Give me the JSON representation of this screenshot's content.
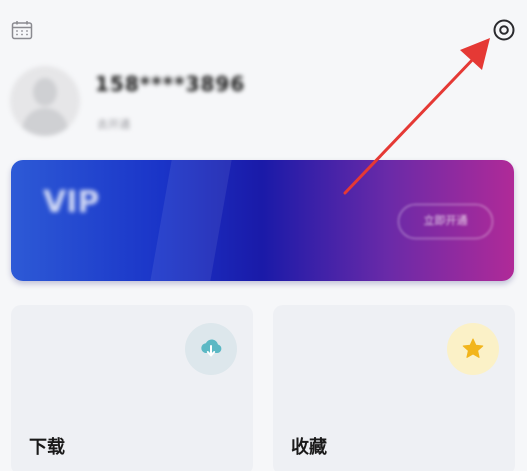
{
  "profile": {
    "phone": "158****3896",
    "subline": "去开通"
  },
  "vip_card": {
    "title": "VIP",
    "subtitle": "",
    "button_label": "立即开通"
  },
  "tiles": [
    {
      "label": "下载",
      "icon": "cloud-download-icon"
    },
    {
      "label": "收藏",
      "icon": "star-icon"
    }
  ],
  "colors": {
    "accent_arrow": "#e53935",
    "download_icon": "#5bb8c4",
    "favorite_icon": "#f2b51c"
  }
}
